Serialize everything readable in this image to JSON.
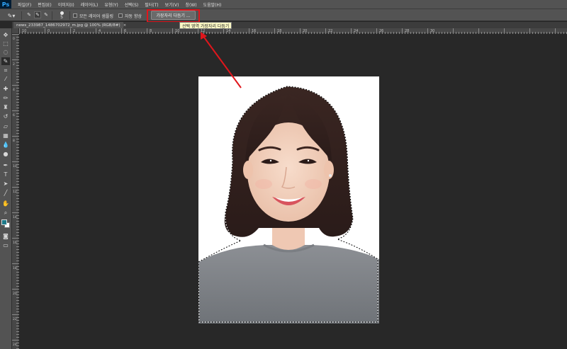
{
  "app": {
    "logo": "Ps"
  },
  "menu": [
    "파일(F)",
    "편집(E)",
    "이미지(I)",
    "레이어(L)",
    "유형(Y)",
    "선택(S)",
    "필터(T)",
    "보기(V)",
    "창(W)",
    "도움말(H)"
  ],
  "options_bar": {
    "tool_icon": "quick-selection-brush-icon",
    "brush_size": "5",
    "sample_all_layers_label": "모든 레이어 샘플링",
    "auto_enhance_label": "자동 향상",
    "refine_edge_label": "가장자리 다듬기 ..."
  },
  "tooltip": {
    "text": "선택 영역 가장자리 다듬기"
  },
  "document_tab": {
    "title": "news_233987_1486702972_m.jpg @ 100% (RGB/8#)",
    "close": "×"
  },
  "ruler_top_ticks": [
    "10",
    "0",
    "2",
    "4",
    "6",
    "8",
    "10",
    "12",
    "14",
    "16",
    "18",
    "20",
    "22",
    "24",
    "26",
    "28",
    "30"
  ],
  "ruler_left_ticks": [
    "0",
    "2",
    "4",
    "6",
    "8",
    "10",
    "12",
    "14",
    "16",
    "18",
    "20",
    "22",
    "24"
  ],
  "colors": {
    "annotation_red": "#e0161c",
    "tooltip_bg": "#fbf8c4",
    "foreground_swatch": "#1e7a8a",
    "background_swatch": "#ffffff"
  },
  "tools": [
    "move-tool-icon",
    "marquee-tool-icon",
    "lasso-tool-icon",
    "quick-selection-tool-icon",
    "crop-tool-icon",
    "eyedropper-tool-icon",
    "healing-brush-icon",
    "brush-tool-icon",
    "clone-stamp-icon",
    "history-brush-icon",
    "eraser-tool-icon",
    "gradient-tool-icon",
    "blur-tool-icon",
    "dodge-tool-icon",
    "pen-tool-icon",
    "type-tool-icon",
    "path-selection-icon",
    "line-tool-icon",
    "hand-tool-icon",
    "zoom-tool-icon"
  ]
}
